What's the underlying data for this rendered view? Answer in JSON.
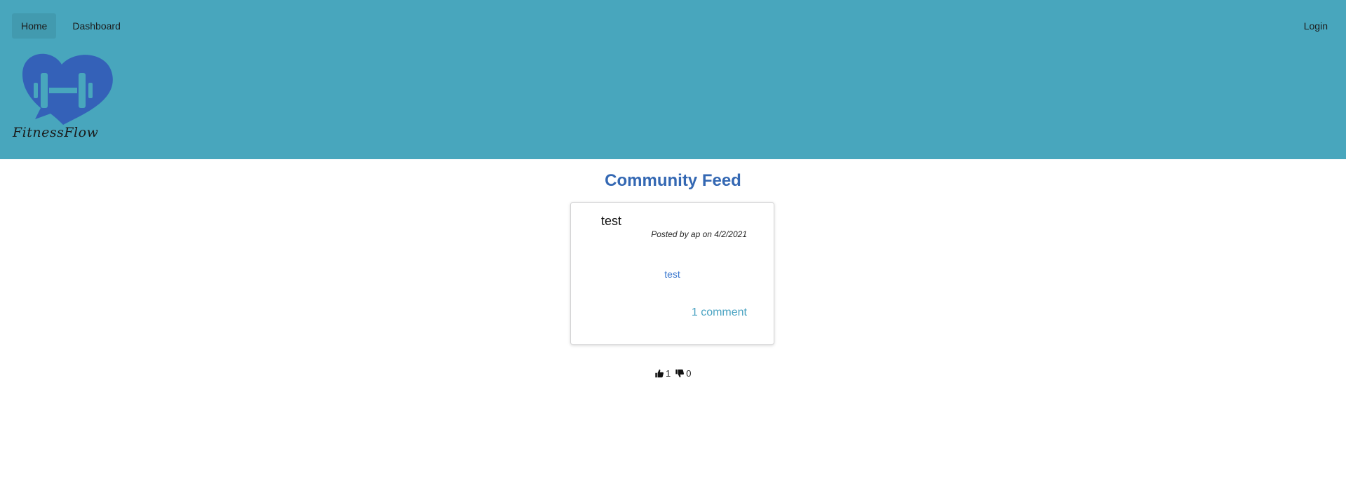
{
  "nav": {
    "home_label": "Home",
    "dashboard_label": "Dashboard",
    "login_label": "Login"
  },
  "brand": {
    "name": "FitnessFlow",
    "logo_icon": "heart-dumbbell-chat-icon",
    "logo_color": "#3461b8"
  },
  "colors": {
    "header_bg": "#48a6bd",
    "title_color": "#3468b3",
    "link_color": "#4aa3c2"
  },
  "feed": {
    "title": "Community Feed",
    "posts": [
      {
        "title": "test",
        "meta": "Posted by ap on 4/2/2021",
        "body": "test",
        "comments_label": "1 comment",
        "likes": "1",
        "dislikes": "0"
      }
    ]
  }
}
